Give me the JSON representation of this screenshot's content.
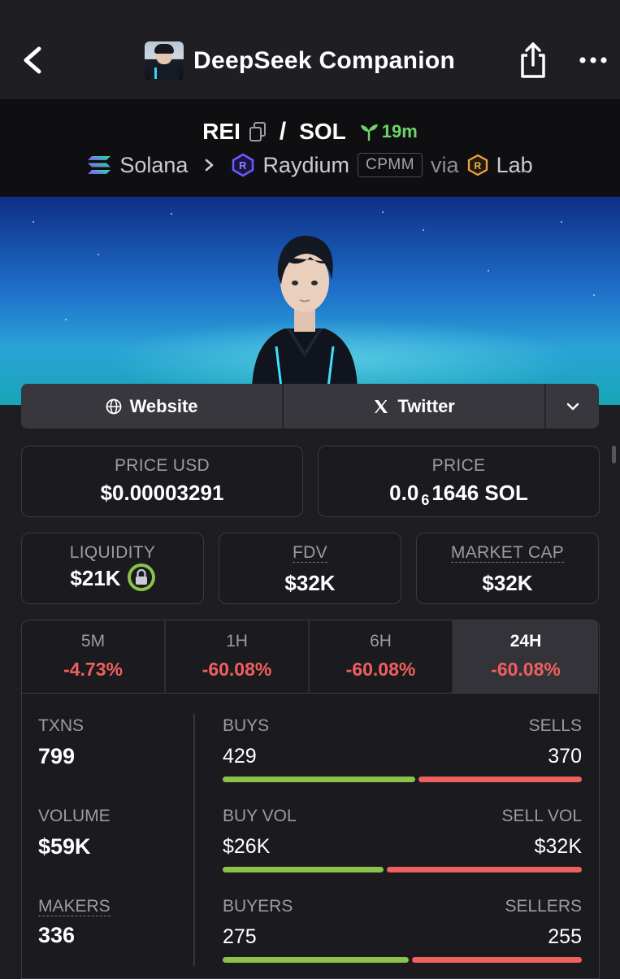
{
  "nav": {
    "title": "DeepSeek Companion",
    "back_icon": "chevron-left-icon",
    "share_icon": "share-icon",
    "more_icon": "more-dots-icon"
  },
  "pair": {
    "base": "REI",
    "quote": "SOL",
    "separator": "/",
    "age": "19m",
    "chain": "Solana",
    "dex": "Raydium",
    "pool_type": "CPMM",
    "via": "via",
    "launchpad": "Lab"
  },
  "links": {
    "website": "Website",
    "twitter": "Twitter"
  },
  "stats": {
    "price_usd_label": "PRICE USD",
    "price_usd": "$0.00003291",
    "price_label": "PRICE",
    "price_prefix": "0.0",
    "price_zero_count": "6",
    "price_suffix": "1646 SOL",
    "liquidity_label": "LIQUIDITY",
    "liquidity": "$21K",
    "fdv_label": "FDV",
    "fdv": "$32K",
    "mcap_label": "MARKET CAP",
    "mcap": "$32K"
  },
  "timeframes": [
    {
      "label": "5M",
      "change": "-4.73%"
    },
    {
      "label": "1H",
      "change": "-60.08%"
    },
    {
      "label": "6H",
      "change": "-60.08%"
    },
    {
      "label": "24H",
      "change": "-60.08%"
    }
  ],
  "active_timeframe": "24H",
  "txns": {
    "txns_label": "TXNS",
    "txns": "799",
    "volume_label": "VOLUME",
    "volume": "$59K",
    "makers_label": "MAKERS",
    "makers": "336",
    "buys_label": "BUYS",
    "buys": "429",
    "sells_label": "SELLS",
    "sells": "370",
    "buy_vol_label": "BUY VOL",
    "buy_vol": "$26K",
    "sell_vol_label": "SELL VOL",
    "sell_vol": "$32K",
    "buyers_label": "BUYERS",
    "buyers": "275",
    "sellers_label": "SELLERS",
    "sellers": "255"
  },
  "bar_shares": {
    "buys": 0.537,
    "buy_vol": 0.448,
    "buyers": 0.519
  },
  "colors": {
    "up": "#8bc34a",
    "down": "#f0605c",
    "age": "#6fd26b"
  }
}
